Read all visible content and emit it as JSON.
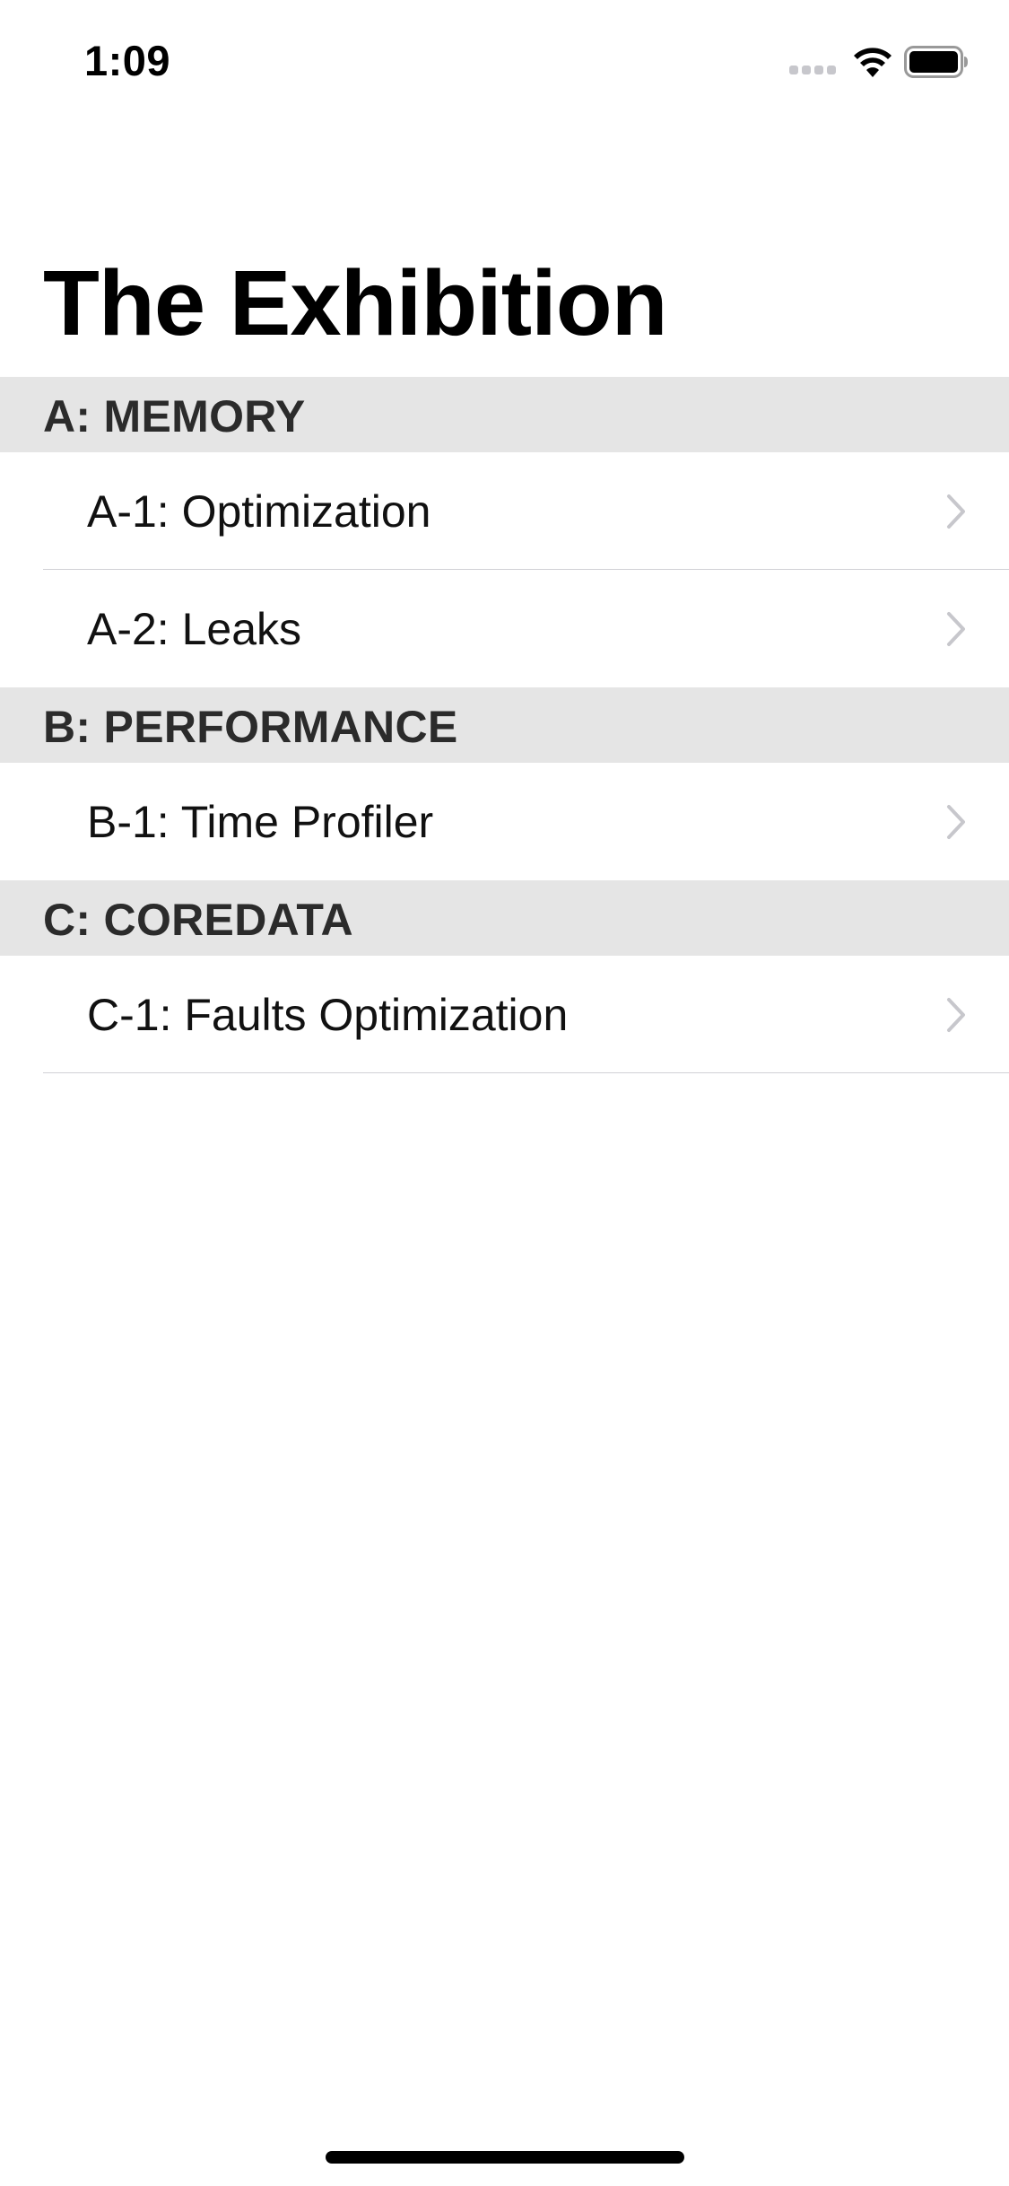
{
  "status_bar": {
    "time": "1:09",
    "icons": [
      "signal-dots-icon",
      "wifi-icon",
      "battery-icon"
    ]
  },
  "navigation": {
    "title": "The Exhibition"
  },
  "sections": [
    {
      "header": "A: MEMORY",
      "rows": [
        {
          "label": "A-1: Optimization"
        },
        {
          "label": "A-2: Leaks"
        }
      ]
    },
    {
      "header": "B: PERFORMANCE",
      "rows": [
        {
          "label": "B-1: Time Profiler"
        }
      ]
    },
    {
      "header": "C: COREDATA",
      "rows": [
        {
          "label": "C-1: Faults Optimization"
        }
      ]
    }
  ],
  "colors": {
    "section_header_bg": "#e5e5e5",
    "chevron": "#c7c7cc",
    "separator": "#d1d1d6"
  }
}
